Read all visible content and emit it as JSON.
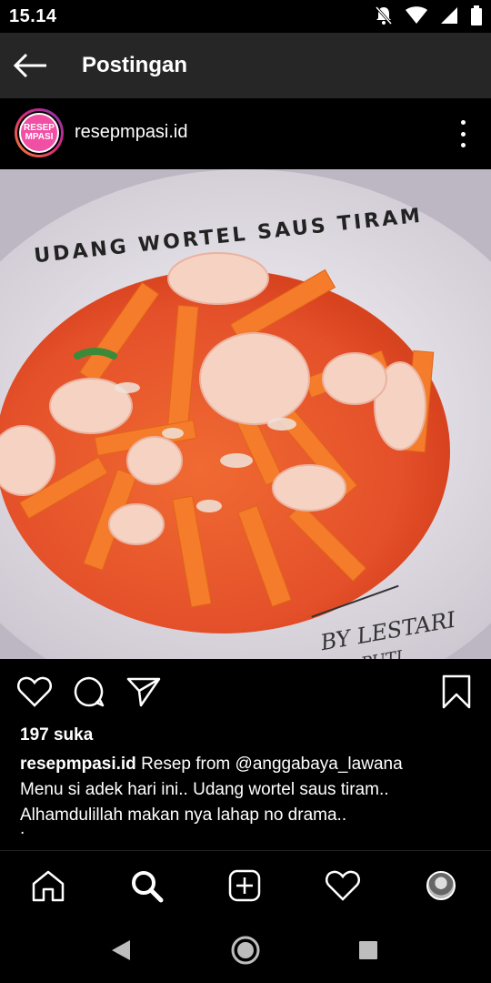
{
  "status_bar": {
    "time": "15.14",
    "icons": [
      "notifications-off-icon",
      "wifi-icon",
      "signal-icon",
      "battery-icon"
    ]
  },
  "app_bar": {
    "title": "Postingan",
    "back_icon": "arrow-left-icon"
  },
  "post": {
    "username": "resepmpasi.id",
    "avatar_logo_lines": [
      "RESEP",
      "MPASI"
    ],
    "image": {
      "overlay_title": "UDANG WORTEL SAUS TIRAM",
      "watermark_line1": "BY LESTARI",
      "watermark_line2": "PUTI"
    },
    "likes": "197 suka",
    "caption_user": "resepmpasi.id",
    "caption_line1": "Resep from @anggabaya_lawana",
    "caption_line2": "Menu si adek hari ini.. Udang wortel saus tiram..",
    "caption_line3": "Alhamdulillah makan nya lahap no drama..",
    "caption_line4": "."
  },
  "actions": [
    "heart-icon",
    "comment-icon",
    "share-icon",
    "bookmark-icon"
  ],
  "bottom_nav": [
    "home-icon",
    "search-icon",
    "add-post-icon",
    "activity-heart-icon",
    "profile-avatar"
  ],
  "system_nav": [
    "back-triangle-icon",
    "home-circle-icon",
    "recents-square-icon"
  ],
  "colors": {
    "app_bar_bg": "#262626",
    "avatar_brand": "#f04fa4",
    "sauce": "#e8542c",
    "carrot": "#f47c2a",
    "plate": "#f2eef3"
  }
}
